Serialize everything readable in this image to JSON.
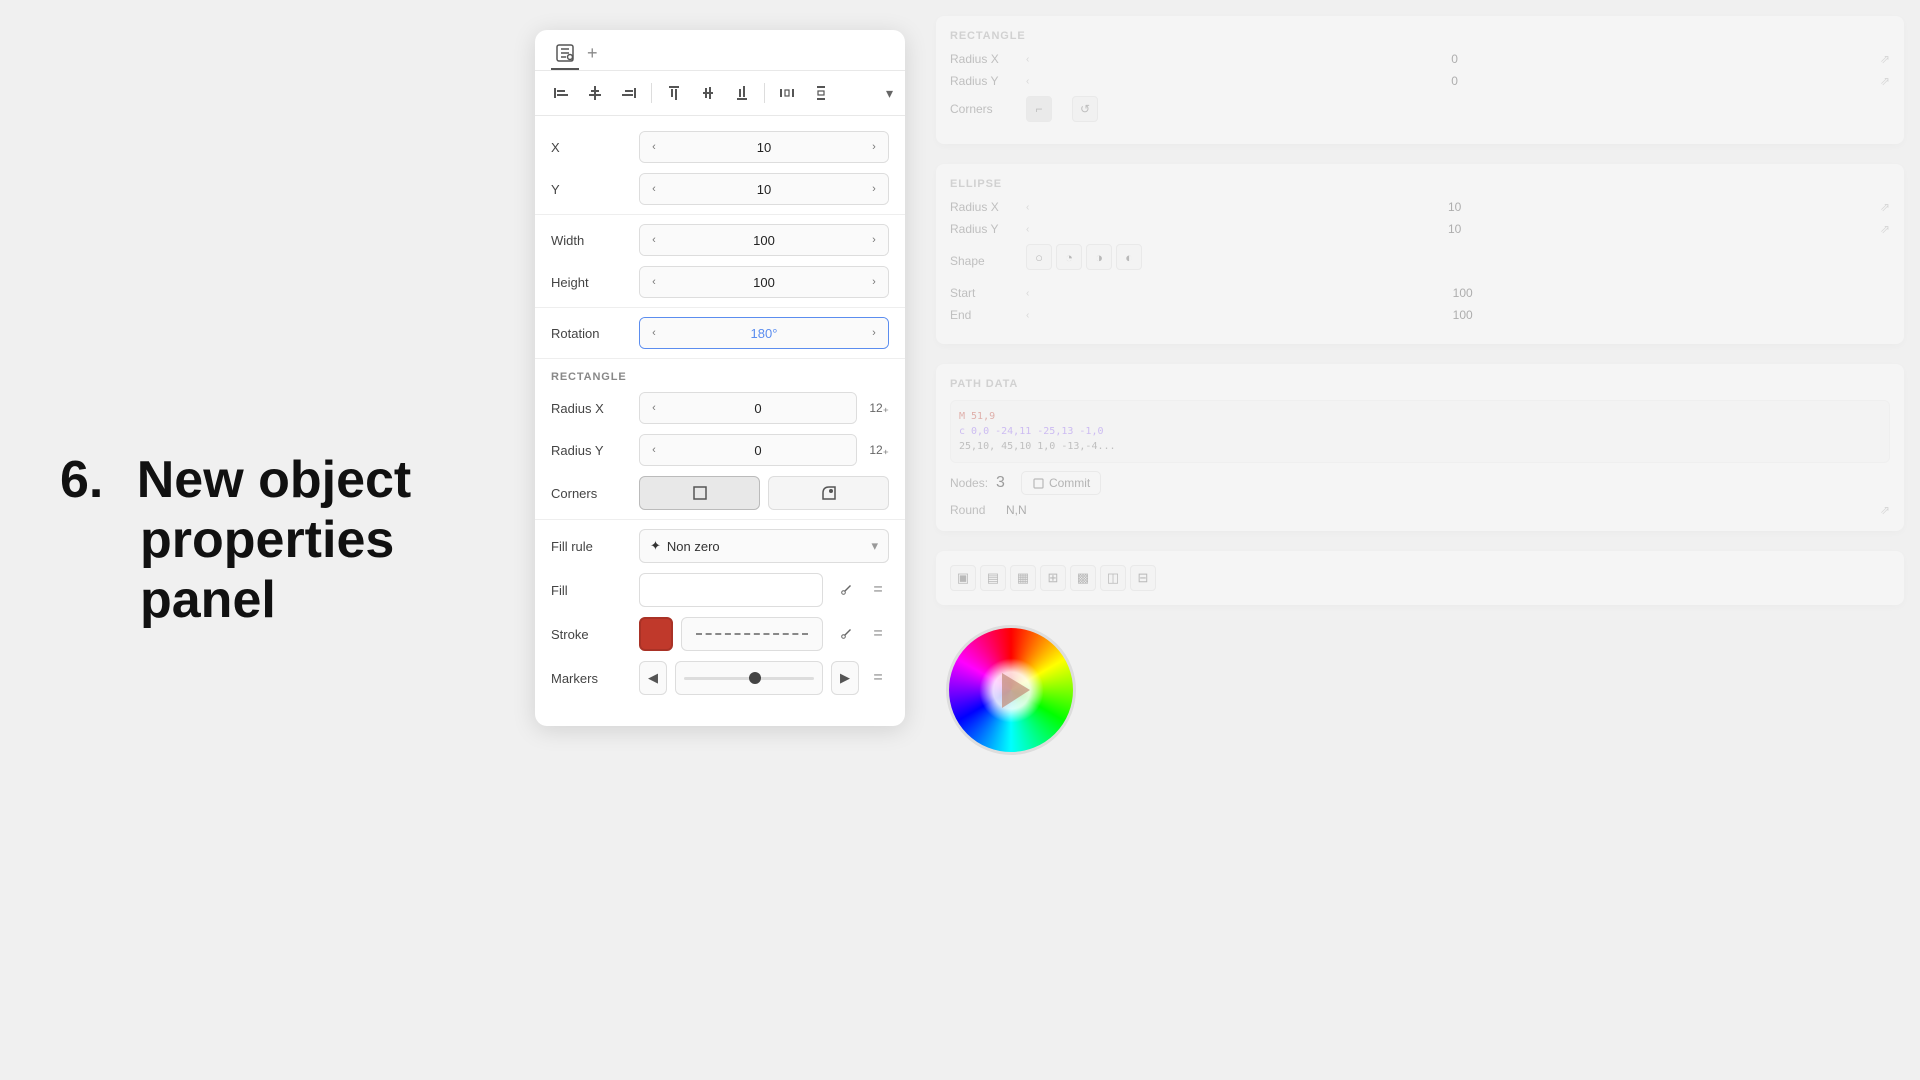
{
  "heading": {
    "number": "6.",
    "line1": "New object",
    "line2": "properties panel"
  },
  "panel": {
    "tab_icon": "⚙",
    "tab_plus": "+",
    "toolbar": {
      "align_left": "⬜",
      "align_center_h": "⬜",
      "align_right": "⬜",
      "align_top": "⬜",
      "align_center_v": "⬜",
      "align_bottom": "⬜",
      "distribute_h": "⬜",
      "distribute_v": "⬜",
      "chevron": "▾"
    },
    "x": {
      "label": "X",
      "value": "10"
    },
    "y": {
      "label": "Y",
      "value": "10"
    },
    "width": {
      "label": "Width",
      "value": "100"
    },
    "height": {
      "label": "Height",
      "value": "100"
    },
    "rotation": {
      "label": "Rotation",
      "value": "180°"
    },
    "rectangle_section": "RECTANGLE",
    "radius_x": {
      "label": "Radius X",
      "value": "0",
      "suffix": "12₊"
    },
    "radius_y": {
      "label": "Radius Y",
      "value": "0",
      "suffix": "12₊"
    },
    "corners": {
      "label": "Corners",
      "btn1": "⌐",
      "btn2": "⌐°"
    },
    "fill_rule": {
      "label": "Fill rule",
      "value": "Non zero"
    },
    "fill": {
      "label": "Fill"
    },
    "stroke": {
      "label": "Stroke"
    },
    "markers": {
      "label": "Markers"
    }
  },
  "right": {
    "rectangle": {
      "title": "RECTANGLE",
      "radius_x": {
        "label": "Radius X",
        "value": "0"
      },
      "radius_y": {
        "label": "Radius Y",
        "value": "0"
      },
      "corners": {
        "label": "Corners"
      }
    },
    "ellipse": {
      "title": "ELLIPSE",
      "radius_x": {
        "label": "Radius X",
        "value": "10"
      },
      "radius_y": {
        "label": "Radius Y",
        "value": "10"
      },
      "shape": {
        "label": "Shape"
      },
      "start": {
        "label": "Start",
        "value": "100"
      },
      "end": {
        "label": "End",
        "value": "100"
      }
    },
    "path_data": {
      "title": "PATH DATA",
      "content_m": "M 51,9",
      "content_c": "c 0,0 -24,11 -25,13 -1,0",
      "content_l": "25,10, 45,10 1,0 -13,-4...",
      "nodes": "3",
      "nodes_label": "Nodes:",
      "commit_label": "Commit",
      "round_label": "Round",
      "round_value": "N,N"
    },
    "layout": {
      "icons": [
        "▣",
        "▣",
        "▣",
        "▣",
        "▣",
        "▣",
        "▣"
      ]
    }
  }
}
